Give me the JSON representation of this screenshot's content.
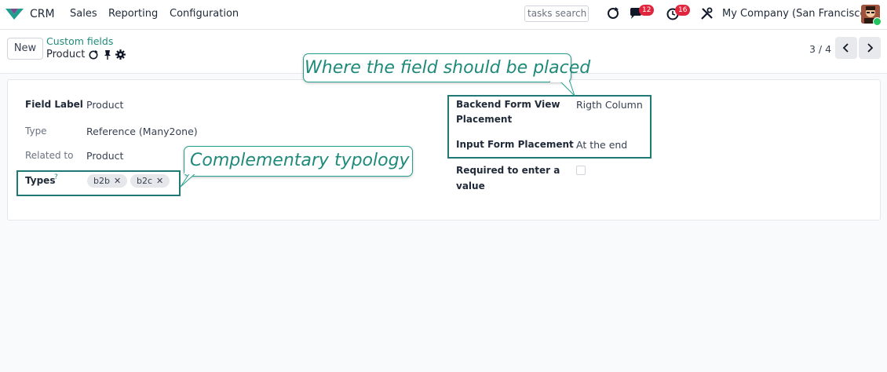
{
  "app": {
    "name": "CRM"
  },
  "menu": [
    {
      "label": "Sales"
    },
    {
      "label": "Reporting"
    },
    {
      "label": "Configuration"
    }
  ],
  "systray": {
    "search_placeholder": "tasks search",
    "messages_count": "12",
    "activities_count": "16",
    "company": "My Company (San Francisco)"
  },
  "control_panel": {
    "new_label": "New",
    "breadcrumb_parent": "Custom fields",
    "breadcrumb_current": "Product",
    "pager": "3 / 4"
  },
  "form": {
    "left": [
      {
        "label": "Field Label",
        "value": "Product"
      },
      {
        "label": "Type",
        "value": "Reference (Many2one)"
      },
      {
        "label": "Related to",
        "value": "Product"
      }
    ],
    "types": {
      "label": "Types",
      "help": "?",
      "tags": [
        "b2b",
        "b2c"
      ]
    },
    "right": {
      "backend_label_line1": "Backend Form View",
      "backend_label_line2": "Placement",
      "backend_value": "Rigth Column",
      "input_label": "Input Form Placement",
      "input_value": "At the end",
      "required_label_line1": "Required to enter a",
      "required_label_line2": "value",
      "required_checked": false
    }
  },
  "annotations": {
    "placement_note": "Where the field should be placed",
    "typology_note": "Complementary typology"
  },
  "colors": {
    "brand": "#1f8a7a",
    "badge": "#e0263d",
    "highlight_border": "#1f7a76"
  }
}
